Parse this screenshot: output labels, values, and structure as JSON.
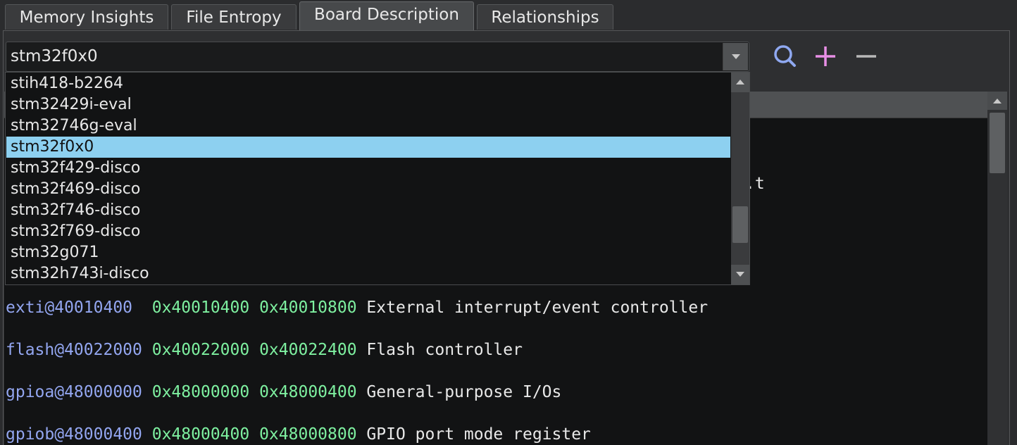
{
  "tabs": [
    {
      "label": "Memory Insights"
    },
    {
      "label": "File Entropy"
    },
    {
      "label": "Board Description"
    },
    {
      "label": "Relationships"
    }
  ],
  "board_select": {
    "value": "stm32f0x0",
    "options": [
      "stih418-b2264",
      "stm32429i-eval",
      "stm32746g-eval",
      "stm32f0x0",
      "stm32f429-disco",
      "stm32f469-disco",
      "stm32f746-disco",
      "stm32f769-disco",
      "stm32g071",
      "stm32h743i-disco"
    ]
  },
  "toolbar": {
    "icons": [
      "search-icon",
      "plus-icon",
      "minus-icon"
    ],
    "colors": {
      "search": "#8fa8f0",
      "plus": "#e88fe6",
      "minus": "#b8b8b8"
    }
  },
  "peripherals": [
    {
      "name": "exti@40010400 ",
      "start": "0x40010400",
      "end": "0x40010800",
      "description": "External interrupt/event controller"
    },
    {
      "name": "flash@40022000",
      "start": "0x40022000",
      "end": "0x40022400",
      "description": "Flash controller"
    },
    {
      "name": "gpioa@48000000",
      "start": "0x48000000",
      "end": "0x48000400",
      "description": "General-purpose I/Os"
    },
    {
      "name": "gpiob@48000400",
      "start": "0x48000400",
      "end": "0x48000800",
      "description": "GPIO port mode register"
    }
  ],
  "clipped_text": ".t",
  "colors": {
    "name": "#93a6f0",
    "address": "#7ef0a0",
    "selection": "#8dd0f0"
  }
}
